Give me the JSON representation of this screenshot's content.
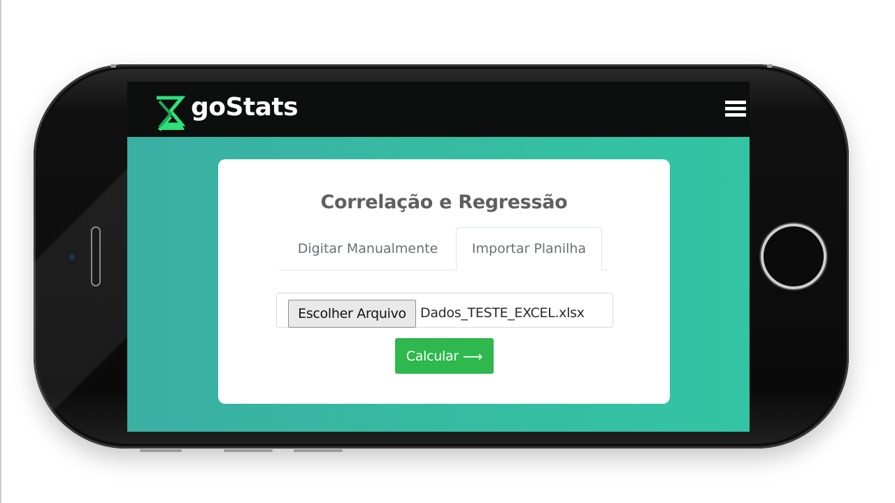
{
  "app": {
    "brand": "goStats"
  },
  "navbar": {
    "logo_icon": "hourglass-icon",
    "menu_icon": "hamburger-menu-icon"
  },
  "card": {
    "title": "Correlação e Regressão",
    "tabs": [
      {
        "label": "Digitar Manualmente",
        "active": false
      },
      {
        "label": "Importar Planilha",
        "active": true
      }
    ],
    "file_input": {
      "button_label": "Escolher Arquivo",
      "file_name": "Dados_TESTE_EXCEL.xlsx"
    },
    "submit": {
      "label": "Calcular",
      "icon": "arrow-right-icon",
      "arrow_glyph": "⟶"
    }
  },
  "colors": {
    "navbar_bg": "#0c0f0e",
    "content_bg": "#38b4a0",
    "logo_green": "#2fe07a",
    "submit_bg": "#2eb84d"
  }
}
